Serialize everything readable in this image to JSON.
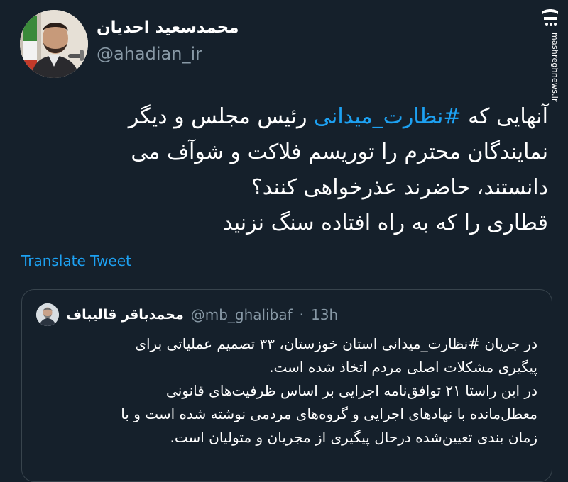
{
  "author": {
    "name": "محمدسعید احدیان",
    "handle": "@ahadian_ir"
  },
  "tweet": {
    "lines": [
      {
        "pre": "آنهایی که ",
        "hashtag": "#نظارت_میدانی",
        "post": " رئیس مجلس و دیگر"
      },
      {
        "text": "نمایندگان محترم را توریسم فلاکت و شوآف می"
      },
      {
        "text": "دانستند، حاضرند عذرخواهی کنند؟"
      },
      {
        "text": "قطاری را که به راه افتاده سنگ نزنید"
      }
    ]
  },
  "translate_label": "Translate Tweet",
  "quote": {
    "name": "محمدباقر قالیباف",
    "handle": "@mb_ghalibaf",
    "separator": "·",
    "time": "13h",
    "lines": [
      {
        "pre": "در جریان ",
        "hashtag": "#نظارت_میدانی",
        "post": " استان خوزستان، ۳۳ تصمیم عملیاتی برای"
      },
      {
        "text": "پیگیری مشکلات اصلی مردم اتخاذ شده است."
      },
      {
        "text": "در این راستا ۲۱ توافق‌نامه اجرایی بر اساس ظرفیت‌های قانونی"
      },
      {
        "text": "معطل‌مانده با نهادهای اجرایی و گروه‌های مردمی نوشته شده است و با"
      },
      {
        "text": "زمان بندی تعیین‌شده درحال پیگیری از مجریان و متولیان است."
      }
    ]
  },
  "watermark": {
    "logo_text": "مشرق",
    "url": "mashreghnews.ir"
  },
  "colors": {
    "background": "#15202b",
    "link": "#1da1f2",
    "muted": "#8899a6",
    "border": "#38444d"
  }
}
